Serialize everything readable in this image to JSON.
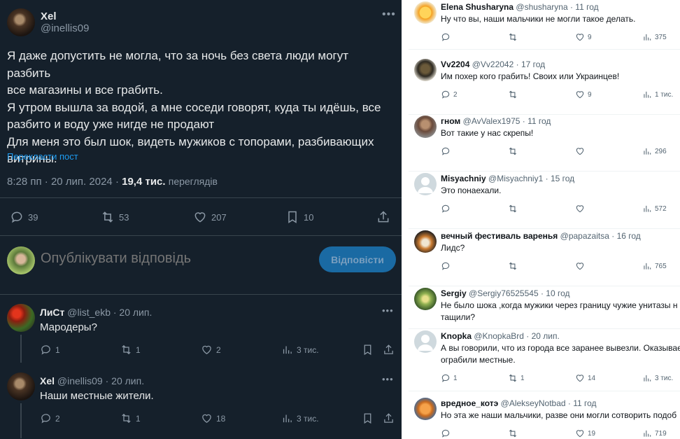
{
  "post": {
    "author_name": "Xel",
    "author_handle": "@inellis09",
    "text_lines": [
      "Я даже допустить не могла, что за ночь без света люди могут разбить",
      "все магазины и все грабить.",
      "Я утром вышла за водой, а мне соседи говорят, куда ты идёшь, все",
      "разбито и воду уже нигде не продают",
      "Для меня это был шок, видеть мужиков с топорами, разбивающих",
      "витрины."
    ],
    "translate_label": "Перекласти пост",
    "time": "8:28 пп",
    "date": "20 лип. 2024",
    "views_count": "19,4 тис.",
    "views_label": "переглядів",
    "more_icon": "•••",
    "stats": {
      "replies": "39",
      "reposts": "53",
      "likes": "207",
      "bookmarks": "10"
    }
  },
  "reply_box": {
    "placeholder": "Опублікувати відповідь",
    "button_label": "Відповісти"
  },
  "left_comments": [
    {
      "name": "ЛиСт",
      "handle": "@list_ekb",
      "date": "· 20 лип.",
      "text": "Мародеры?",
      "replies": "1",
      "reposts": "1",
      "likes": "2",
      "views": "3 тис."
    },
    {
      "name": "Xel",
      "handle": "@inellis09",
      "date": "· 20 лип.",
      "text": "Наши местные жители.",
      "replies": "2",
      "reposts": "1",
      "likes": "18",
      "views": "3 тис."
    }
  ],
  "right_comments": [
    {
      "name": "Elena Shusharyna",
      "handle": "@shusharyna",
      "date": "· 11 год",
      "lines": [
        "Ну что вы, наши мальчики не могли такое делать."
      ],
      "replies": "",
      "reposts": "",
      "likes": "9",
      "views": "375"
    },
    {
      "name": "Vv2204",
      "handle": "@Vv22042",
      "date": "· 17 год",
      "lines": [
        "Им похер кого грабить! Своих или Украинцев!"
      ],
      "replies": "2",
      "reposts": "",
      "likes": "9",
      "views": "1 тис."
    },
    {
      "name": "гном",
      "handle": "@AvValex1975",
      "date": "· 11 год",
      "lines": [
        "Вот такие у нас скрепы!"
      ],
      "replies": "",
      "reposts": "",
      "likes": "",
      "views": "296"
    },
    {
      "name": "Misyachniy",
      "handle": "@Misyachniy1",
      "date": "· 15 год",
      "lines": [
        "Это понаехали."
      ],
      "replies": "",
      "reposts": "",
      "likes": "",
      "views": "572"
    },
    {
      "name": "вечный фестиваль варенья",
      "handle": "@papazaitsa",
      "date": "· 16 год",
      "lines": [
        "Лидс?"
      ],
      "replies": "",
      "reposts": "",
      "likes": "",
      "views": "765"
    },
    {
      "name": "Sergiy",
      "handle": "@Sergiy76525545",
      "date": "· 10 год",
      "lines": [
        "Не было шока ,когда мужики через границу чужие унитазы н",
        "тащили?"
      ]
    },
    {
      "name": "Knopka",
      "handle": "@KnopkaBrd",
      "date": "· 20 лип.",
      "lines": [
        "А вы говорили, что из города все заранее вывезли. Оказывае",
        "ограбили местные."
      ],
      "replies": "1",
      "reposts": "1",
      "likes": "14",
      "views": "3 тис."
    },
    {
      "name": "вредное_котэ",
      "handle": "@AlekseyNotbad",
      "date": "· 11 год",
      "lines": [
        "Но эта же наши мальчики, разве они могли сотворить подоб"
      ],
      "replies": "",
      "reposts": "",
      "likes": "19",
      "views": "719"
    }
  ]
}
